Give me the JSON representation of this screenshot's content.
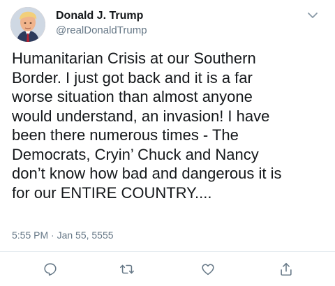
{
  "author": {
    "name": "Donald J. Trump",
    "handle": "@realDonaldTrump",
    "avatar_icon": "profile-avatar"
  },
  "tweet": {
    "text": "Humanitarian Crisis at our Southern\nBorder. I just got back and it is a far\nworse situation than almost anyone\nwould understand, an invasion! I have\nbeen there numerous times - The\nDemocrats, Cryin’ Chuck and Nancy\ndon’t know how bad and dangerous it is\nfor our ENTIRE COUNTRY....",
    "timestamp": "5:55 PM · Jan 55, 5555"
  },
  "actions": [
    {
      "name": "reply",
      "icon": "reply-icon"
    },
    {
      "name": "retweet",
      "icon": "retweet-icon"
    },
    {
      "name": "like",
      "icon": "heart-icon"
    },
    {
      "name": "share",
      "icon": "share-icon"
    }
  ],
  "colors": {
    "text": "#14171a",
    "secondary": "#657786",
    "divider": "#e6ecf0"
  }
}
